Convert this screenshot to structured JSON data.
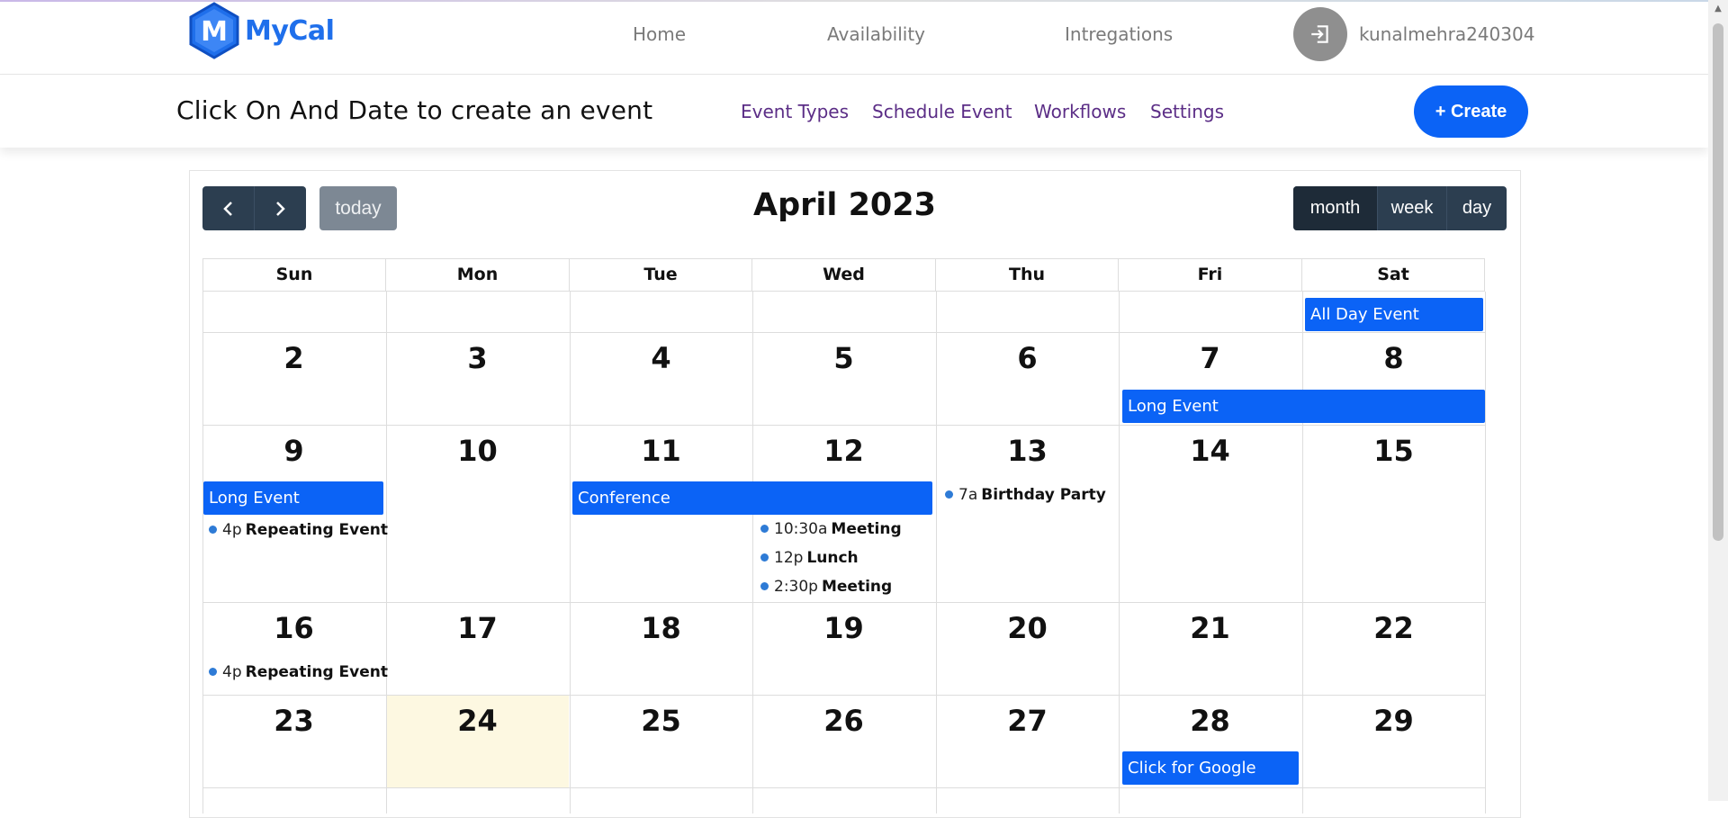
{
  "app": {
    "name": "MyCal",
    "logo_letter": "M"
  },
  "nav": {
    "links": [
      "Home",
      "Availability",
      "Intregations"
    ],
    "username": "kunalmehra240304"
  },
  "subheader": {
    "title": "Click On And Date to create an event",
    "links": [
      "Event Types",
      "Schedule Event",
      "Workflows",
      "Settings"
    ],
    "create_label": "+ Create"
  },
  "calendar": {
    "title": "April 2023",
    "today_label": "today",
    "views": [
      "month",
      "week",
      "day"
    ],
    "active_view": "month",
    "weekdays": [
      "Sun",
      "Mon",
      "Tue",
      "Wed",
      "Thu",
      "Fri",
      "Sat"
    ],
    "weeks": [
      [
        "",
        "",
        "",
        "",
        "",
        "",
        ""
      ],
      [
        "2",
        "3",
        "4",
        "5",
        "6",
        "7",
        "8"
      ],
      [
        "9",
        "10",
        "11",
        "12",
        "13",
        "14",
        "15"
      ],
      [
        "16",
        "17",
        "18",
        "19",
        "20",
        "21",
        "22"
      ],
      [
        "23",
        "24",
        "25",
        "26",
        "27",
        "28",
        "29"
      ]
    ],
    "today_date": "24",
    "events": {
      "all_day": "All Day Event",
      "long_event_w2": "Long Event",
      "long_event_w3": "Long Event",
      "conference": "Conference",
      "birthday": {
        "time": "7a",
        "name": "Birthday Party"
      },
      "repeating_w3": {
        "time": "4p",
        "name": "Repeating Event"
      },
      "meeting1": {
        "time": "10:30a",
        "name": "Meeting"
      },
      "lunch": {
        "time": "12p",
        "name": "Lunch"
      },
      "meeting2": {
        "time": "2:30p",
        "name": "Meeting"
      },
      "repeating_w4": {
        "time": "4p",
        "name": "Repeating Event"
      },
      "google": "Click for Google"
    }
  },
  "colors": {
    "brand": "#1f6feb",
    "event": "#0b63f6",
    "toolbar": "#2c3e50",
    "today_bg": "#fdf8e1",
    "link_purple": "#5b2d86"
  }
}
